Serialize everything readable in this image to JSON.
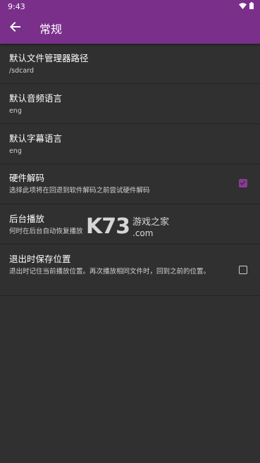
{
  "status_bar": {
    "time": "9:43"
  },
  "appbar": {
    "title": "常规"
  },
  "settings": [
    {
      "title": "默认文件管理器路径",
      "subtitle": "/sdcard"
    },
    {
      "title": "默认音频语言",
      "subtitle": "eng"
    },
    {
      "title": "默认字幕语言",
      "subtitle": "eng"
    },
    {
      "title": "硬件解码",
      "subtitle": "选择此项将在回退到软件解码之前尝试硬件解码",
      "checked": true
    },
    {
      "title": "后台播放",
      "subtitle": "何时在后台自动恢复播放"
    },
    {
      "title": "退出时保存位置",
      "subtitle": "退出时记住当前播放位置。再次播放相同文件时，回到之前的位置。",
      "checked": false
    }
  ],
  "watermark": {
    "brand": "K73",
    "name": "游戏之家",
    "domain": ".com"
  },
  "colors": {
    "accent": "#7a2f8a",
    "background": "#303030",
    "checkbox_checked": "#8a3a97"
  }
}
